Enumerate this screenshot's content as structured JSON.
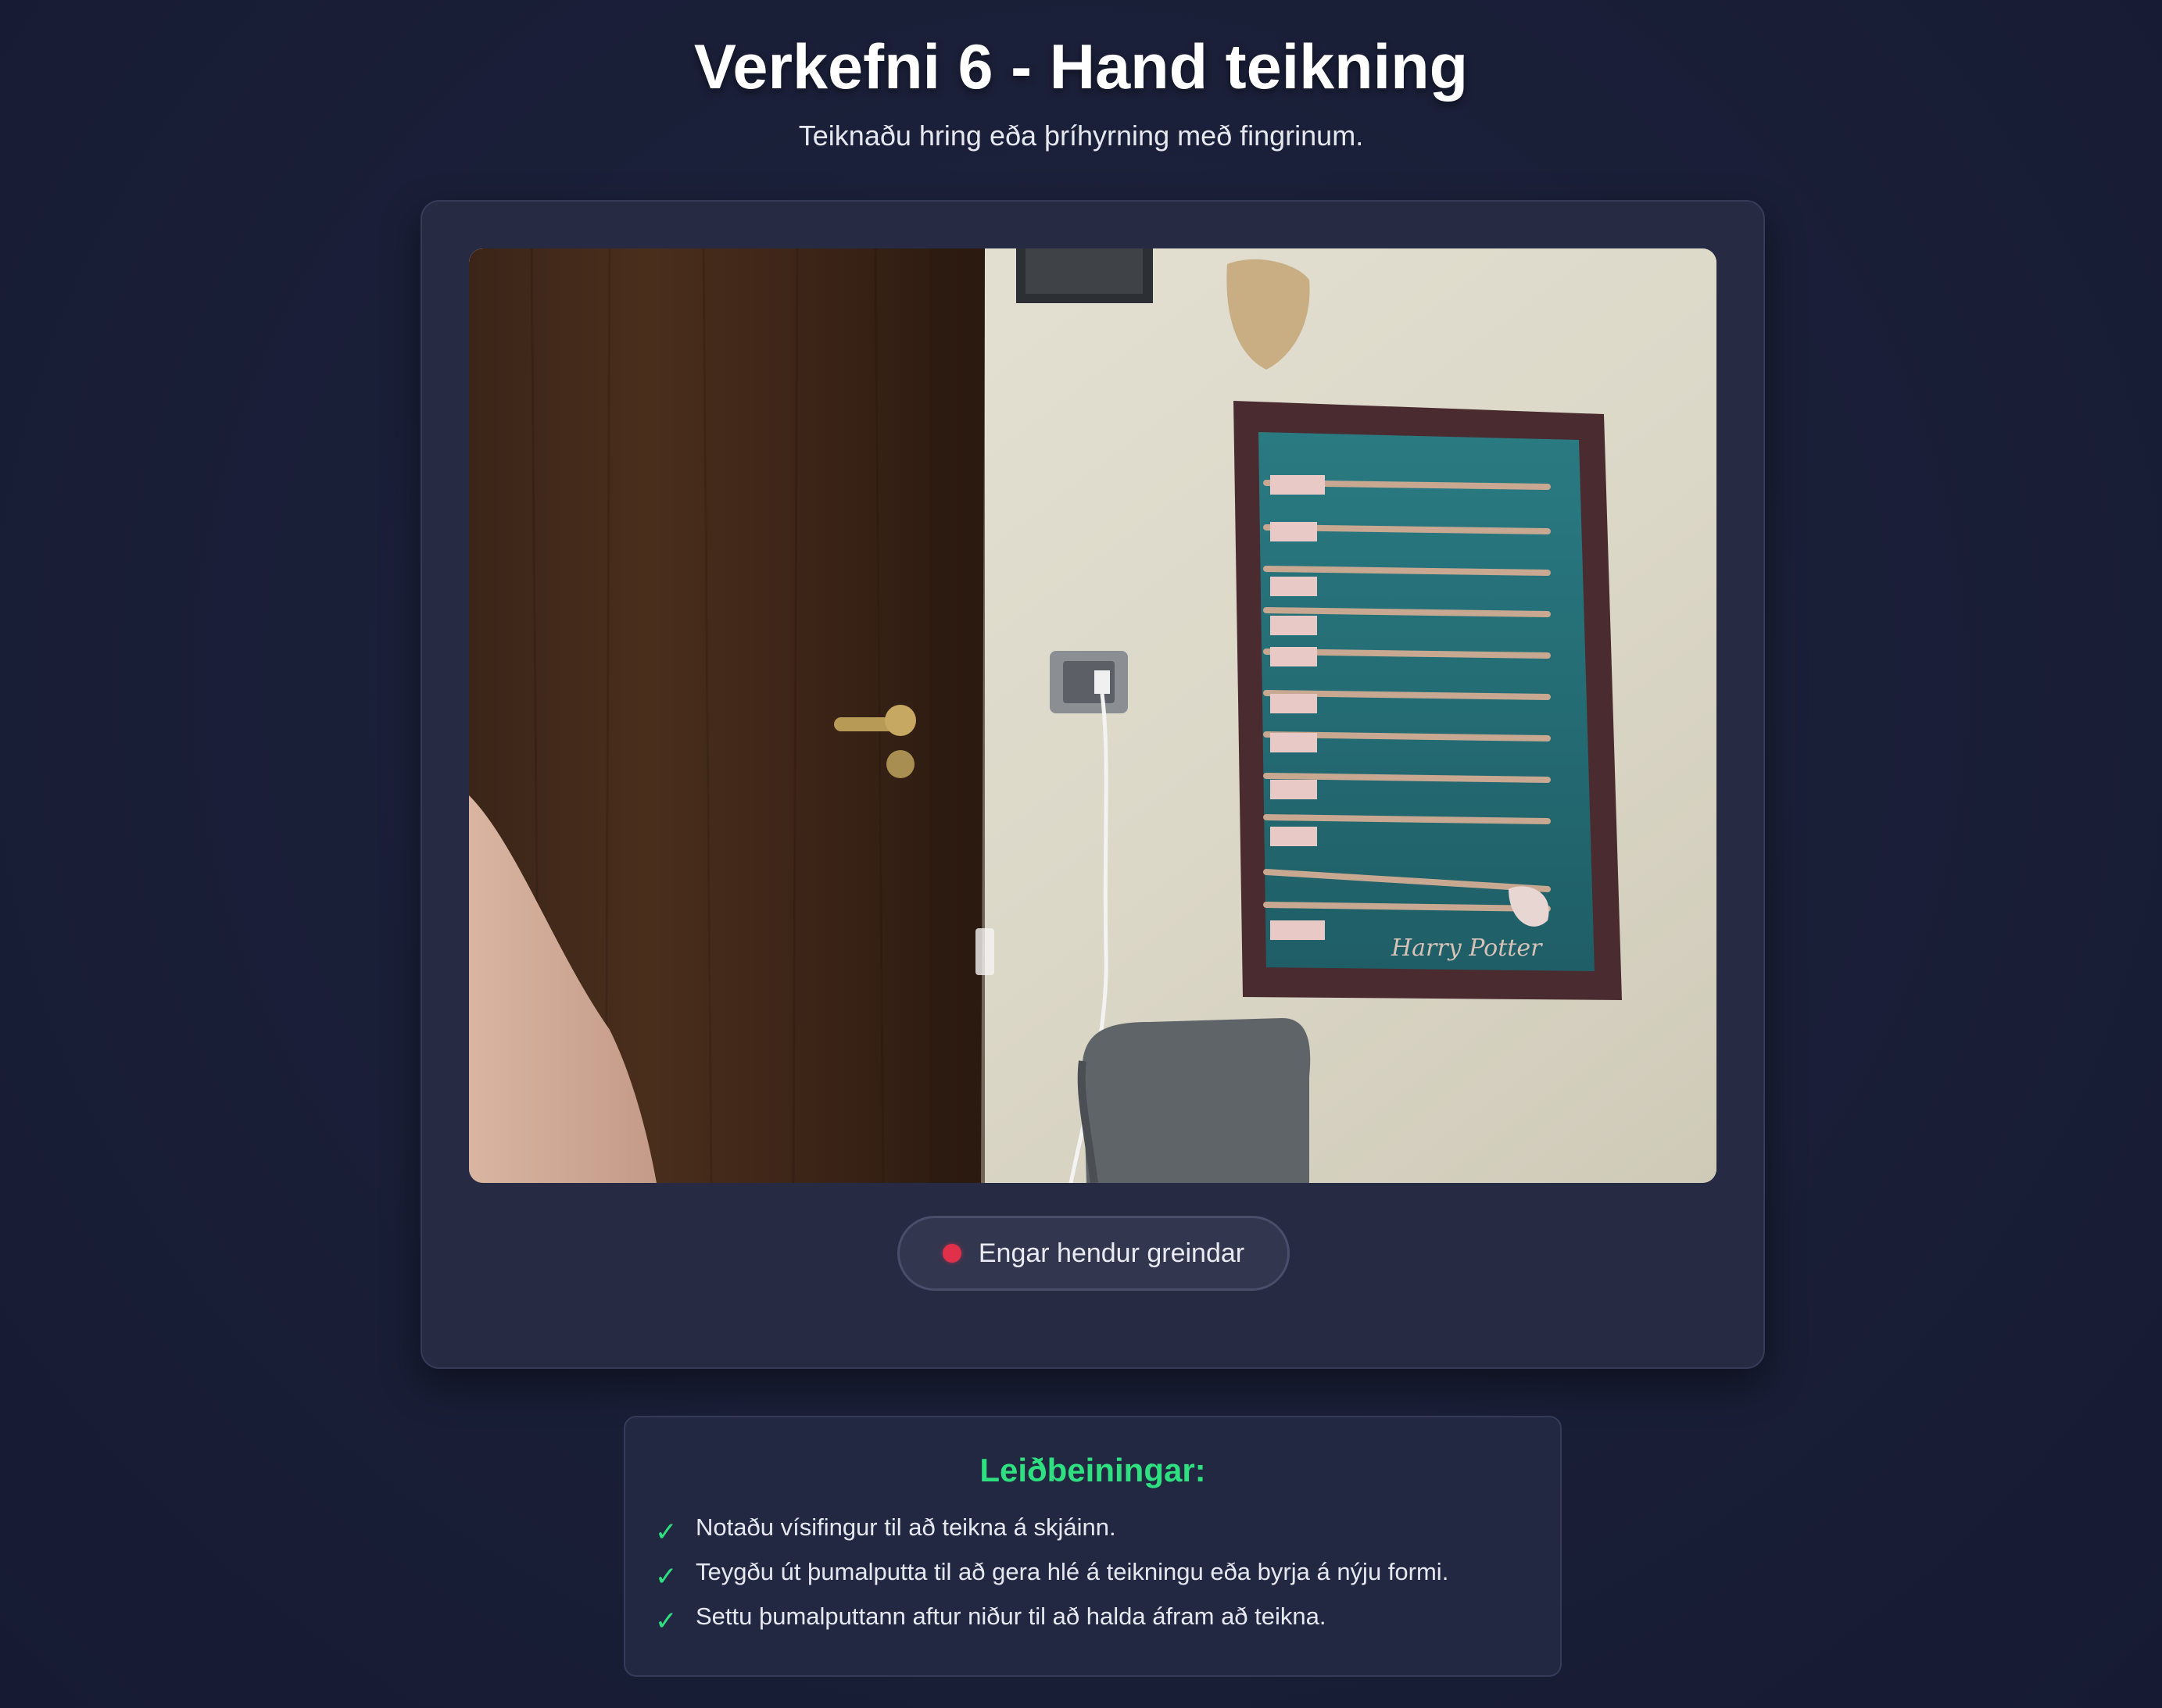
{
  "header": {
    "title": "Verkefni 6 - Hand teikning",
    "subtitle": "Teiknaðu hring eða þríhyrning með fingrinum."
  },
  "camera": {
    "poster_text": "Harry Potter"
  },
  "status": {
    "label": "Engar hendur greindar",
    "dot_color": "#e0304a"
  },
  "instructions": {
    "heading": "Leiðbeiningar:",
    "items": [
      {
        "icon": "check-icon",
        "text": "Notaðu vísifingur til að teikna á skjáinn."
      },
      {
        "icon": "check-icon",
        "text": "Teygðu út þumalputta til að gera hlé á teikningu eða byrja á nýju formi."
      },
      {
        "icon": "check-icon",
        "text": "Settu þumalputtann aftur niður til að halda áfram að teikna."
      }
    ]
  },
  "colors": {
    "accent": "#2ee07f",
    "background": "#1a1f38",
    "card": "#262a42"
  }
}
